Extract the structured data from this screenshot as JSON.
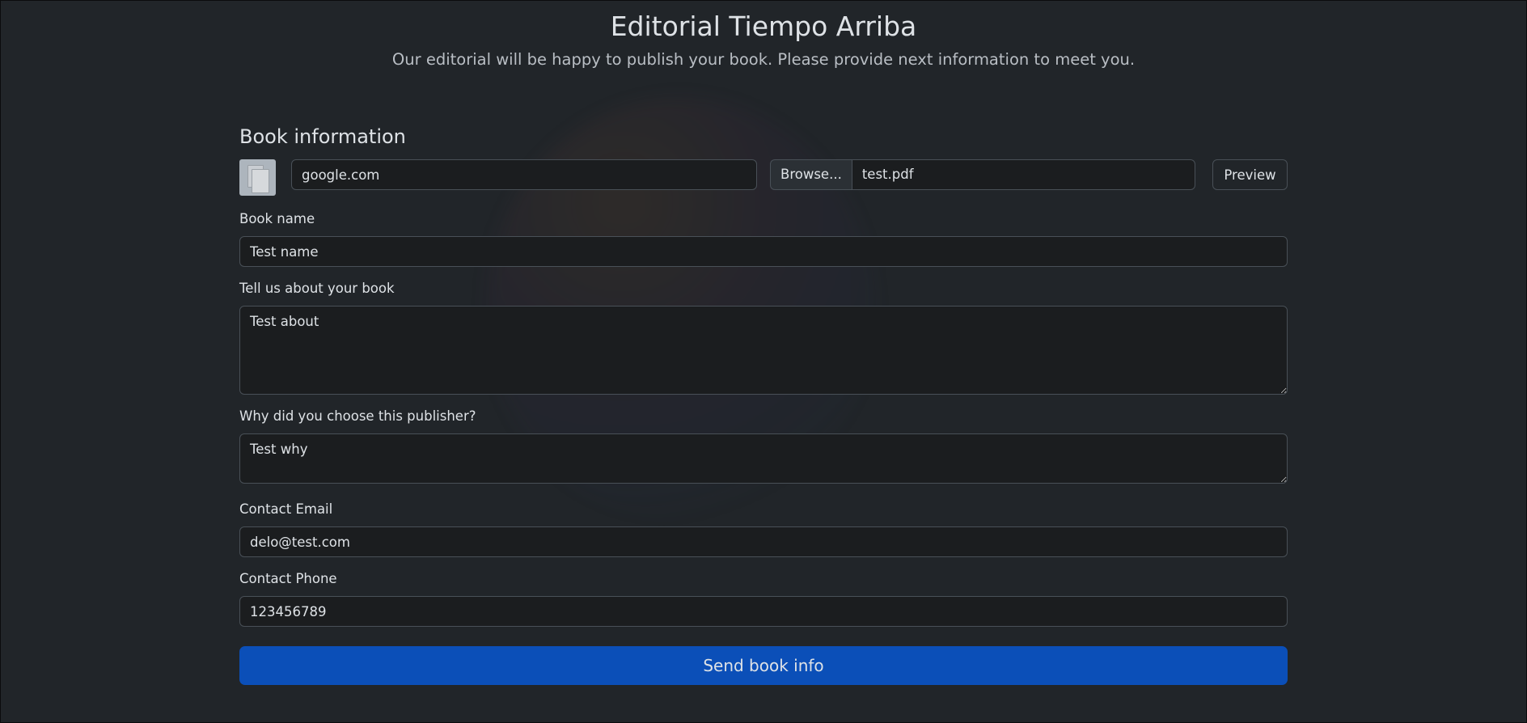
{
  "header": {
    "title": "Editorial Tiempo Arriba",
    "subtitle": "Our editorial will be happy to publish your book. Please provide next information to meet you."
  },
  "book_info": {
    "section_title": "Book information",
    "thumbnail_icon": "document-thumbnail-icon",
    "url_value": "google.com",
    "browse_label": "Browse...",
    "file_name": "test.pdf",
    "preview_label": "Preview"
  },
  "fields": {
    "book_name": {
      "label": "Book name",
      "value": "Test name"
    },
    "about": {
      "label": "Tell us about your book",
      "value": "Test about"
    },
    "why": {
      "label": "Why did you choose this publisher?",
      "value": "Test why"
    },
    "email": {
      "label": "Contact Email",
      "value": "delo@test.com"
    },
    "phone": {
      "label": "Contact Phone",
      "value": "123456789"
    }
  },
  "submit": {
    "label": "Send book info"
  },
  "colors": {
    "background": "#212529",
    "primary": "#0b4fb8",
    "border": "#495057"
  }
}
